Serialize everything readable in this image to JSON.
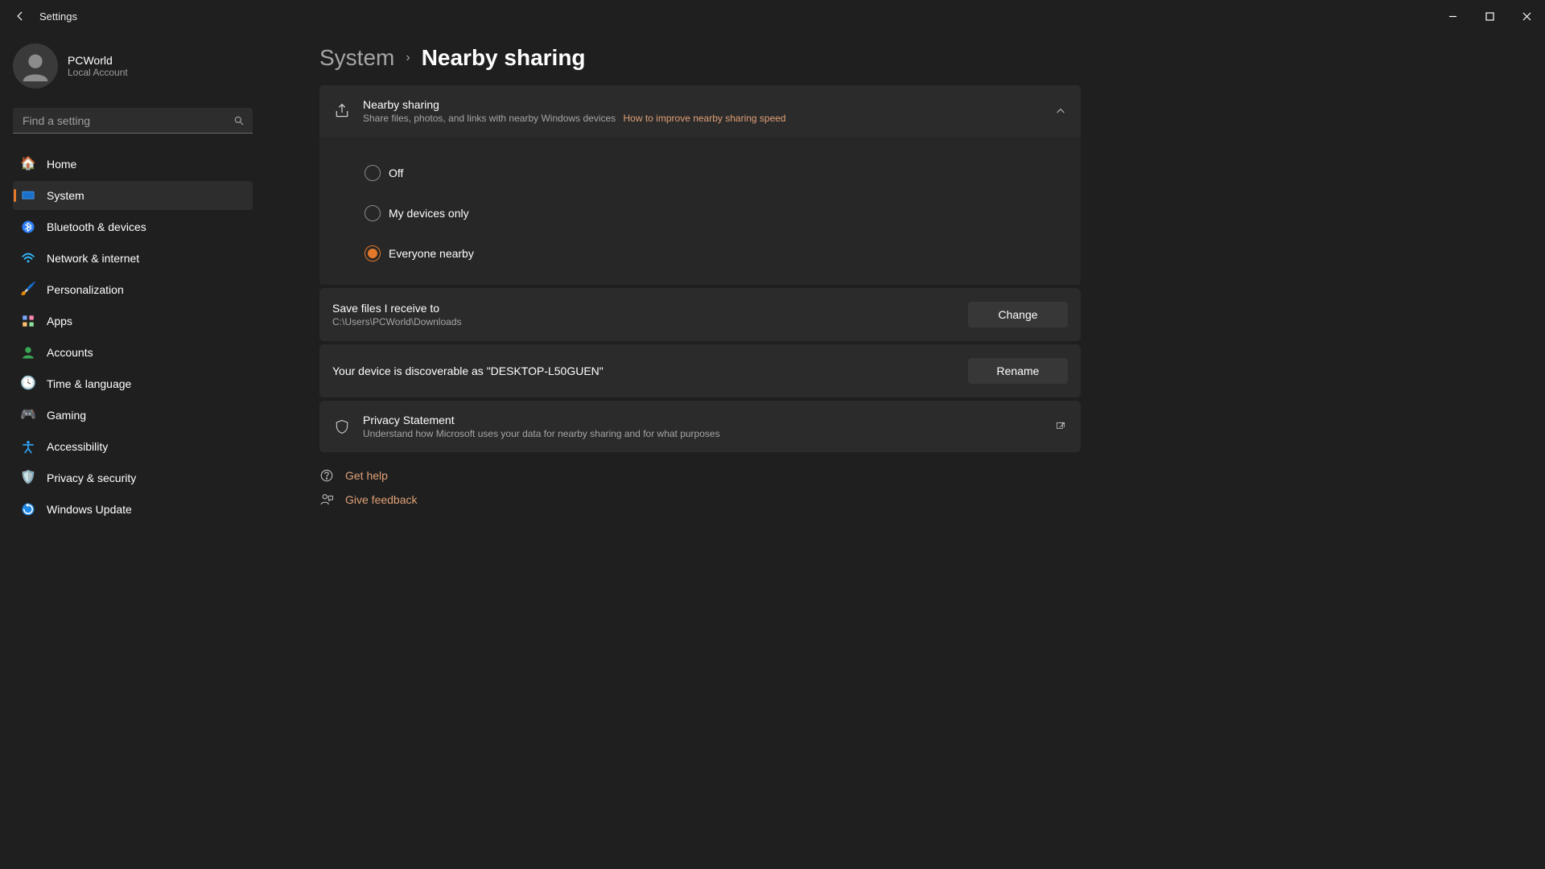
{
  "titlebar": {
    "title": "Settings"
  },
  "profile": {
    "name": "PCWorld",
    "sub": "Local Account"
  },
  "search": {
    "placeholder": "Find a setting"
  },
  "nav": {
    "home": "Home",
    "system": "System",
    "bluetooth": "Bluetooth & devices",
    "network": "Network & internet",
    "personalization": "Personalization",
    "apps": "Apps",
    "accounts": "Accounts",
    "time": "Time & language",
    "gaming": "Gaming",
    "accessibility": "Accessibility",
    "privacy": "Privacy & security",
    "update": "Windows Update"
  },
  "breadcrumb": {
    "parent": "System",
    "current": "Nearby sharing"
  },
  "nearby": {
    "title": "Nearby sharing",
    "sub": "Share files, photos, and links with nearby Windows devices",
    "help": "How to improve nearby sharing speed",
    "options": {
      "off": "Off",
      "mine": "My devices only",
      "everyone": "Everyone nearby"
    }
  },
  "save": {
    "title": "Save files I receive to",
    "path": "C:\\Users\\PCWorld\\Downloads",
    "button": "Change"
  },
  "discover": {
    "text": "Your device is discoverable as \"DESKTOP-L50GUEN\"",
    "button": "Rename"
  },
  "privacy_card": {
    "title": "Privacy Statement",
    "sub": "Understand how Microsoft uses your data for nearby sharing and for what purposes"
  },
  "footer": {
    "help": "Get help",
    "feedback": "Give feedback"
  }
}
